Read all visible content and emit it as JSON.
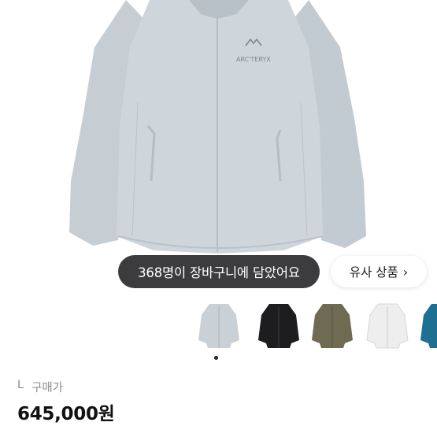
{
  "product": {
    "logo_text": "ARC'TERYX",
    "cart_notice": "368명이 장바구니에 담았어요",
    "similar_label": "유사 상품",
    "similar_icon": "chevron-right-icon",
    "size": "L",
    "price_label": "구매가",
    "price": "645,000원",
    "image_count": 1,
    "current_image": 1
  },
  "thumbnails": [
    {
      "color": "#c9d0d6",
      "name": "light-grey-jacket"
    },
    {
      "color": "#1d1d1f",
      "name": "black-jacket"
    },
    {
      "color": "#6f6a52",
      "name": "olive-jacket"
    },
    {
      "color": "#eeeeee",
      "name": "white-jacket"
    },
    {
      "color": "#1f6f93",
      "name": "blue-jacket"
    }
  ]
}
